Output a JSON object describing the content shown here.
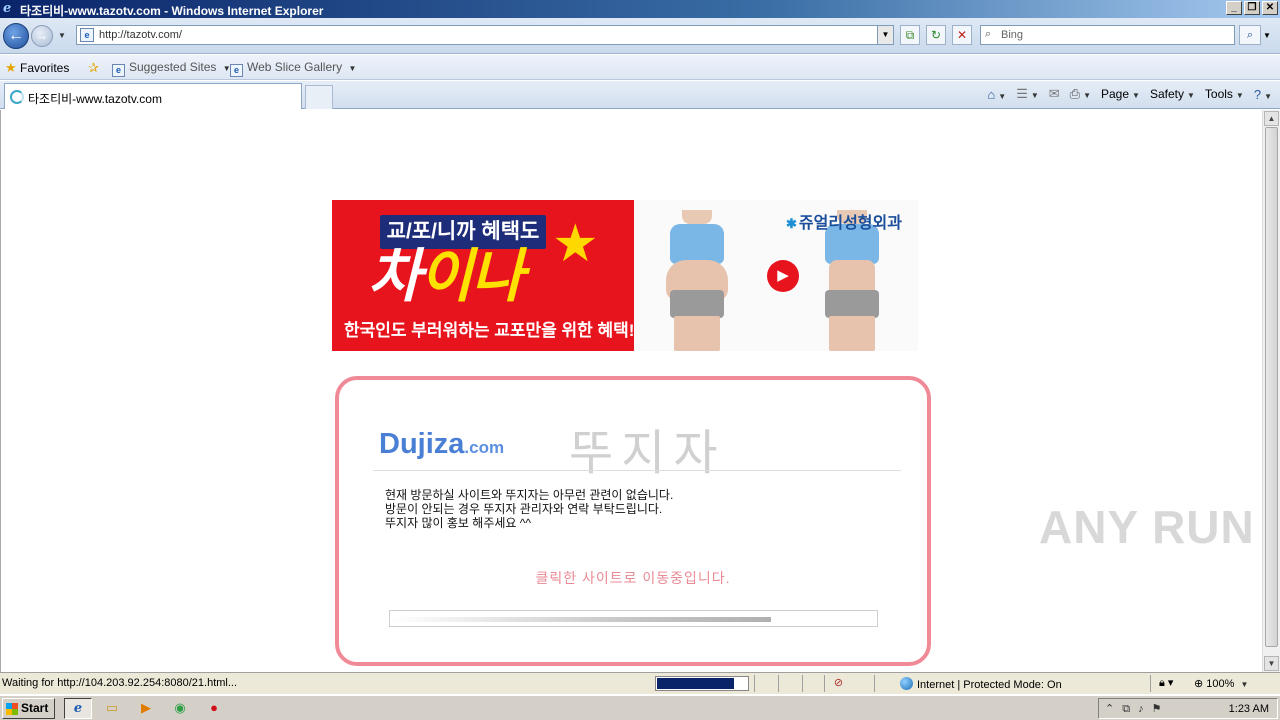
{
  "window": {
    "title": "타조티비-www.tazotv.com - Windows Internet Explorer",
    "controls": [
      "_",
      "❐",
      "✕"
    ]
  },
  "navigation": {
    "url": "http://tazotv.com/",
    "search_placeholder": "Bing"
  },
  "favorites_bar": {
    "favorites_label": "Favorites",
    "items": [
      {
        "label": "Suggested Sites"
      },
      {
        "label": "Web Slice Gallery"
      }
    ]
  },
  "tab": {
    "title": "타조티비-www.tazotv.com"
  },
  "command_bar": {
    "page_label": "Page",
    "safety_label": "Safety",
    "tools_label": "Tools"
  },
  "banner": {
    "tag": "교/포/니까 혜택도",
    "headline_white": "차",
    "headline_yellow": "이나",
    "subline": "한국인도 부러워하는 교포만을 위한 혜택!",
    "clinic_name": "쥬얼리성형외과"
  },
  "dujiza": {
    "logo_main": "Dujiza",
    "logo_suffix": ".com",
    "title": "뚜지자",
    "message_lines": [
      "현재 방문하실 사이트와 뚜지자는 아무런 관련이 없습니다.",
      "방문이 안되는 경우 뚜지자 관리자와 연락 부탁드립니다.",
      "뚜지자 많이 홍보 해주세요 ^^"
    ],
    "redirect_text": "클릭한 사이트로 이동중입니다.",
    "progress_percent": 78
  },
  "watermark": "ANY RUN",
  "status_bar": {
    "status_text": "Waiting for http://104.203.92.254:8080/21.html...",
    "load_progress_percent": 85,
    "zone": "Internet | Protected Mode: On",
    "zoom": "100%"
  },
  "taskbar": {
    "start_label": "Start",
    "clock": "1:23 AM"
  }
}
